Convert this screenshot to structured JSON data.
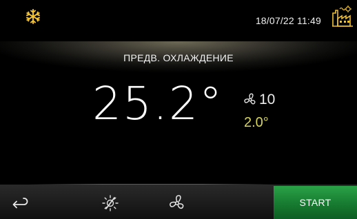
{
  "header": {
    "datetime": "18/07/22 11:49",
    "mode_icon": "snowflake-icon",
    "status_icon": "factory-icon",
    "accent_color": "#f2c230"
  },
  "main": {
    "mode_title": "ПРЕДВ. ОХЛАЖДЕНИЕ",
    "temperature": "25.2°",
    "fan_speed": "10",
    "differential": "2.0°",
    "differential_color": "#d7d55a"
  },
  "footer": {
    "back_icon": "back-arrow-icon",
    "defrost_icon": "defrost-off-icon",
    "fan_icon": "fan-icon",
    "start_label": "START",
    "start_color": "#1f8f3a"
  }
}
